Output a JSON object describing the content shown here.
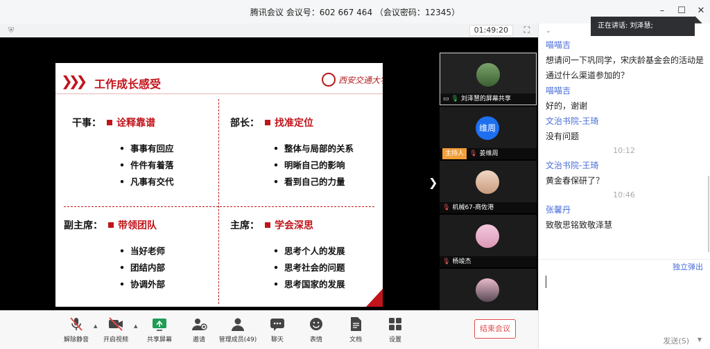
{
  "window": {
    "title": "腾讯会议 会议号：602 667 464 （会议密码：12345）",
    "controls": [
      "minimize",
      "maximize",
      "close"
    ]
  },
  "meeting": {
    "timer": "01:49:20"
  },
  "slide": {
    "title": "工作成长感受",
    "logo_text": "西安交通大学",
    "quadrants": [
      {
        "role": "干事：",
        "theme": "诠释靠谱",
        "items": [
          "事事有回应",
          "件件有着落",
          "凡事有交代"
        ]
      },
      {
        "role": "部长：",
        "theme": "找准定位",
        "items": [
          "整体与局部的关系",
          "明晰自己的影响",
          "看到自己的力量"
        ]
      },
      {
        "role": "副主席：",
        "theme": "带领团队",
        "items": [
          "当好老师",
          "团结内部",
          "协调外部"
        ]
      },
      {
        "role": "主席：",
        "theme": "学会深思",
        "items": [
          "思考个人的发展",
          "思考社会的问题",
          "思考国家的发展"
        ]
      }
    ]
  },
  "participants": [
    {
      "name": "刘泽慧的屏幕共享",
      "mic": "on",
      "host": false
    },
    {
      "name": "姜维周",
      "mic": "off",
      "host": true,
      "host_label": "主持人",
      "avatar_text": "维周"
    },
    {
      "name": "机械67-商佐港",
      "mic": "off",
      "host": false
    },
    {
      "name": "杨竣杰",
      "mic": "off",
      "host": false
    },
    {
      "name": "",
      "mic": "off",
      "host": false
    }
  ],
  "toolbar": {
    "unmute": "解除静音",
    "start_video": "开启视频",
    "share_screen": "共享屏幕",
    "invite": "邀请",
    "manage_members": "管理成员(49)",
    "chat": "聊天",
    "emoji": "表情",
    "docs": "文档",
    "settings": "设置",
    "end_meeting": "结束会议"
  },
  "chat": {
    "speaking_now": "正在讲话: 刘泽慧;",
    "messages": [
      {
        "sender": "喵喵吉",
        "text": "想请问一下巩同学，宋庆龄基金会的活动是通过什么渠道参加的？"
      },
      {
        "sender": "喵喵吉",
        "text": "好的，谢谢"
      },
      {
        "sender": "文治书院-王琦",
        "text": "没有问题"
      },
      {
        "time": "10:12",
        "sender": "文治书院-王琦",
        "text": "黄金春保研了？"
      },
      {
        "time": "10:46",
        "sender": "张馨丹",
        "text": "致敬思铭致敬泽慧"
      }
    ],
    "popout": "独立弹出",
    "send": "发送(S)"
  }
}
